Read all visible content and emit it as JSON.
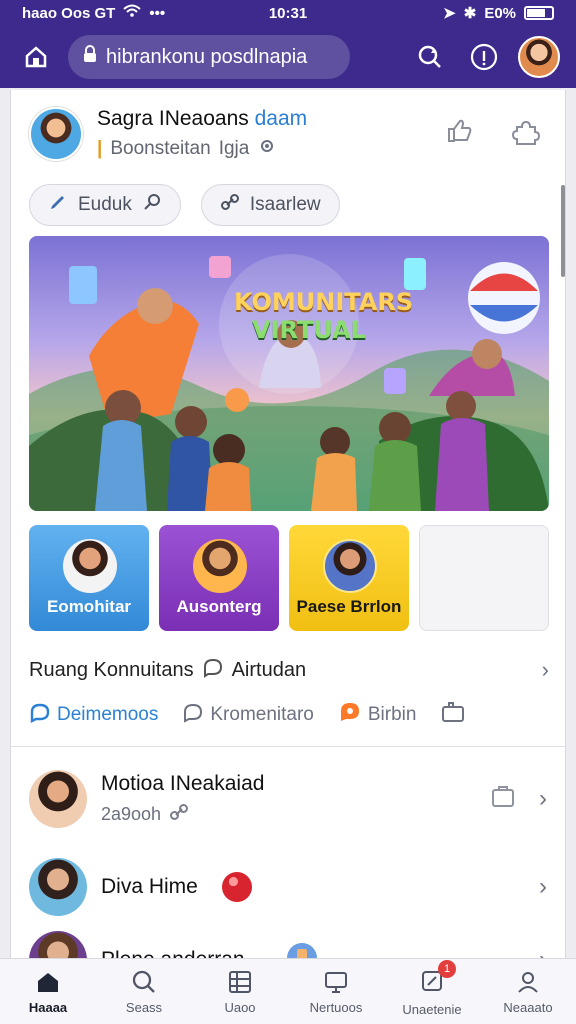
{
  "status_bar": {
    "left_text": "haao Oos GT",
    "time": "10:31",
    "battery": "E0%"
  },
  "top_bar": {
    "url": "hibrankonu posdlnapia"
  },
  "profile": {
    "name_main": "Sagra INeaoans",
    "name_highlight": "daam",
    "subtitle_main": "Boonsteitan",
    "subtitle_extra": "Igja"
  },
  "chips": [
    {
      "label": "Euduk"
    },
    {
      "label": "Isaarlew"
    }
  ],
  "banner": {
    "title": "KOMUNITARS",
    "subtitle": "VIRTUAL"
  },
  "cards": [
    {
      "label": "Eomohitar"
    },
    {
      "label": "Ausonterg"
    },
    {
      "label": "Paese Brrlon"
    },
    {
      "label": ""
    }
  ],
  "section": {
    "title": "Ruang Konnuitans",
    "extra": "Airtudan"
  },
  "filters": [
    {
      "label": "Deimemoos"
    },
    {
      "label": "Kromenitaro"
    },
    {
      "label": "Birbin"
    }
  ],
  "list": [
    {
      "title": "Motioa INeakaiad",
      "subtitle": "2a9ooh"
    },
    {
      "title": "Diva Hime",
      "subtitle": ""
    },
    {
      "title": "Plene anderran",
      "subtitle": ""
    }
  ],
  "tabs": [
    {
      "label": "Haaaa"
    },
    {
      "label": "Seass"
    },
    {
      "label": "Uaoo"
    },
    {
      "label": "Nertuoos"
    },
    {
      "label": "Unaetenie",
      "badge": "1"
    },
    {
      "label": "Neaaato"
    }
  ],
  "colors": {
    "header": "#3d2a8c",
    "accent": "#2b82d4",
    "card_blue": "#3f98e4",
    "card_purple": "#8b3fc7",
    "card_yellow": "#f6cc22"
  }
}
